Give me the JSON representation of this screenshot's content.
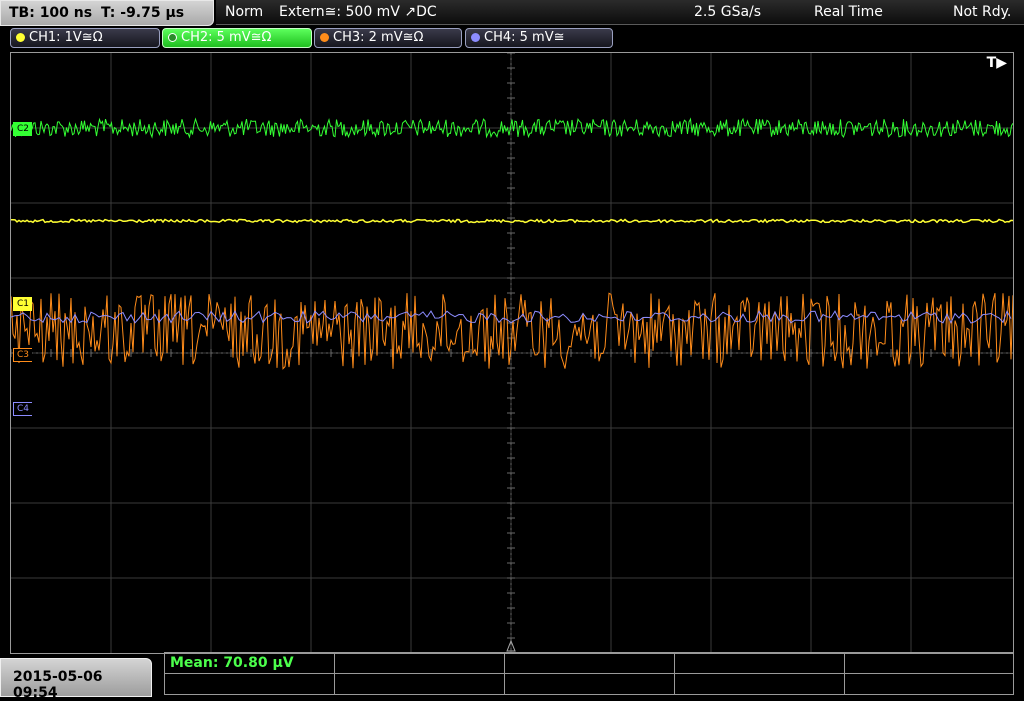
{
  "header": {
    "timebase": "TB: 100 ns",
    "trigger_time": "T: -9.75 µs",
    "mode": "Norm",
    "trigger_source": "Extern≅: 500 mV ↗DC",
    "sample_rate": "2.5 GSa/s",
    "acq_mode": "Real Time",
    "status": "Not Rdy."
  },
  "channels": [
    {
      "label": "CH1: 1V≅Ω",
      "color": "#ffff33",
      "active": false
    },
    {
      "label": "CH2: 5 mV≅Ω",
      "color": "#33ff33",
      "active": true
    },
    {
      "label": "CH3: 2 mV≅Ω",
      "color": "#ff8c1a",
      "active": false
    },
    {
      "label": "CH4: 5 mV≅",
      "color": "#8c8cff",
      "active": false
    }
  ],
  "markers": {
    "c2": "C2",
    "c1": "C1",
    "c3": "C3",
    "c4": "C4"
  },
  "trigger_marker": "T▶",
  "footer": {
    "datetime": "2015-05-06 09:54",
    "measurement": "Mean: 70.80 µV"
  },
  "colors": {
    "ch1": "#ffff33",
    "ch2": "#33ff33",
    "ch3": "#ff8c1a",
    "ch4": "#8c8cff",
    "grid": "#3a3a3a"
  }
}
